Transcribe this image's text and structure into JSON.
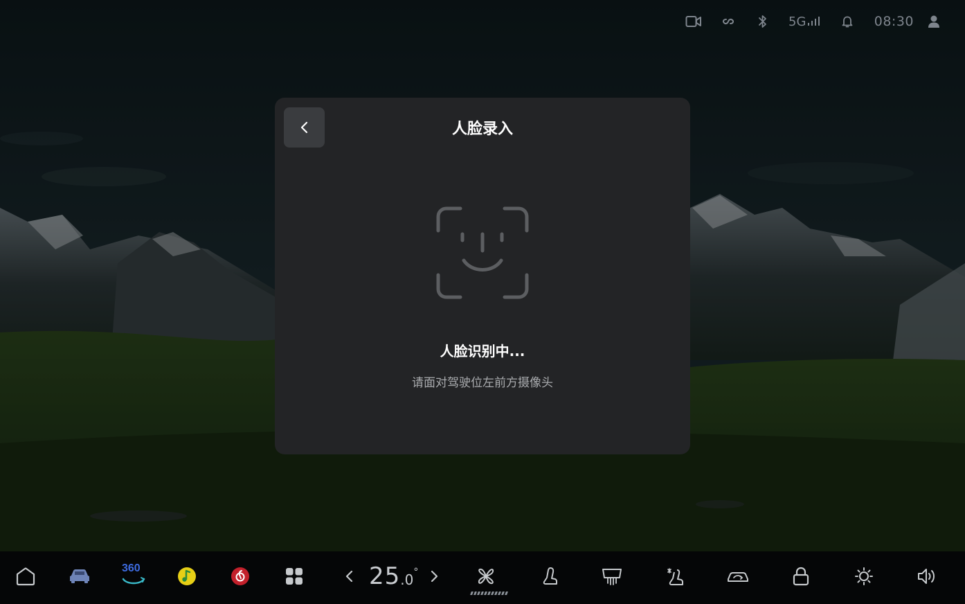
{
  "status_bar": {
    "icons": [
      "camera-icon",
      "link-icon",
      "bluetooth-icon"
    ],
    "network": "5G",
    "time": "08:30",
    "trailing_icons": [
      "bell-icon",
      "user-icon"
    ]
  },
  "dialog": {
    "title": "人脸录入",
    "back_icon": "chevron-left-icon",
    "face_icon": "face-id-icon",
    "status": "人脸识别中...",
    "hint": "请面对驾驶位左前方摄像头"
  },
  "dock": {
    "items": [
      "home-icon",
      "car-icon",
      "360-view-icon",
      "music-app-icon",
      "netease-music-icon",
      "apps-grid-icon"
    ],
    "app_360_label": "360",
    "temperature": {
      "integer": "25",
      "decimal": ".0",
      "unit": "°"
    },
    "climate_items": [
      "fan-icon",
      "seat-heat-icon",
      "rear-defrost-icon",
      "seat-vent-icon",
      "car-recirculation-icon",
      "lock-icon",
      "brightness-icon",
      "volume-icon"
    ]
  },
  "colors": {
    "dialog_bg": "#232426",
    "back_button_bg": "#3a3c3f",
    "dock_bg": "#050607",
    "accent_red": "#c3202b",
    "accent_yellow": "#e7cf16",
    "accent_blue": "#3d6be0"
  }
}
